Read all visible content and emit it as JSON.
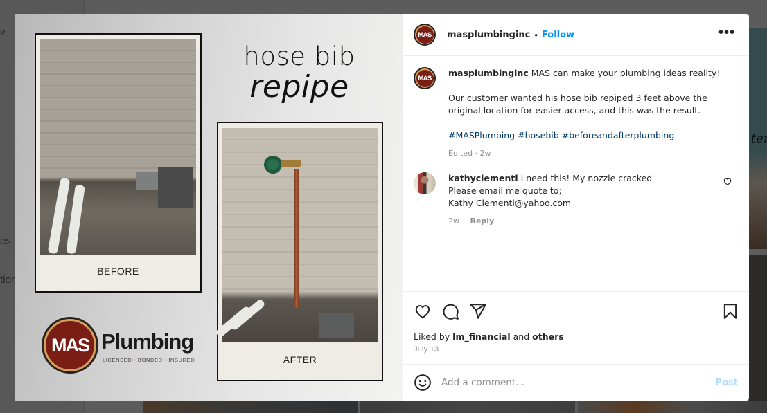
{
  "background": {
    "sidebar_fragments": [
      "v",
      "es",
      "tion"
    ],
    "right_tile_text": "ter"
  },
  "media": {
    "title_line1": "hose bib",
    "title_line2": "repipe",
    "before_caption": "BEFORE",
    "after_caption": "AFTER",
    "logo": {
      "mark": "MAS",
      "wordmark": "Plumbing",
      "tagline": [
        "LICENSED",
        "BONDED",
        "INSURED"
      ],
      "tag_separator": "•"
    }
  },
  "post": {
    "header": {
      "avatar_text": "MAS",
      "username": "masplumbinginc",
      "separator": "•",
      "follow_label": "Follow",
      "more_label": "•••"
    },
    "caption": {
      "username": "masplumbinginc",
      "line1": "MAS can make your plumbing ideas reality!",
      "paragraph2": "Our customer wanted his hose bib repiped 3 feet above the original location for easier access, and this was the result.",
      "hashtags": [
        "#MASPlumbing",
        "#hosebib",
        "#beforeandafterplumbing"
      ],
      "meta": "Edited · 2w"
    },
    "comments": [
      {
        "username": "kathyclementi",
        "line1": "I need this! My nozzle cracked",
        "line2": "Please email me quote to;",
        "line3": "Kathy Clementi@yahoo.com",
        "time": "2w",
        "reply_label": "Reply"
      }
    ],
    "likes": {
      "prefix": "Liked by",
      "user": "lm_financial",
      "connector": "and",
      "others": "others"
    },
    "date": "July 13",
    "add_comment": {
      "placeholder": "Add a comment...",
      "value": "",
      "post_label": "Post"
    },
    "colors": {
      "link_blue": "#0095f6",
      "hashtag": "#00376b",
      "post_disabled": "#b2dffc",
      "brand_red": "#7a1d14"
    }
  }
}
